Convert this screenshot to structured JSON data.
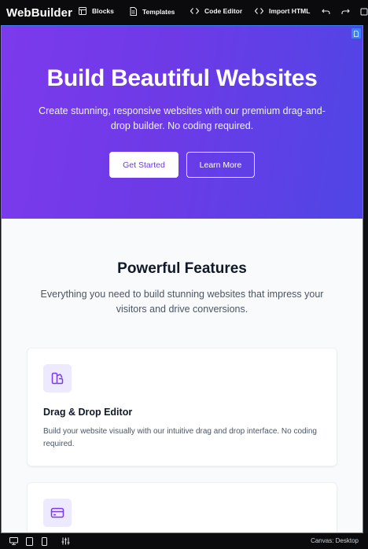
{
  "app": {
    "brand": "WebBuilder"
  },
  "toolbar": {
    "blocks_label": "Blocks",
    "templates_label": "Templates",
    "code_editor_label": "Code Editor",
    "import_html_label": "Import HTML"
  },
  "hero": {
    "title": "Build Beautiful Websites",
    "subtitle": "Create stunning, responsive websites with our premium drag-and-drop builder. No coding required.",
    "primary_button": "Get Started",
    "secondary_button": "Learn More"
  },
  "features": {
    "title": "Powerful Features",
    "subtitle": "Everything you need to build stunning websites that impress your visitors and drive conversions.",
    "cards": [
      {
        "title": "Drag & Drop Editor",
        "text": "Build your website visually with our intuitive drag and drop interface. No coding required.",
        "icon": "palette-icon"
      },
      {
        "title": "",
        "text": "",
        "icon": "credit-card-icon"
      }
    ]
  },
  "bottombar": {
    "canvas_status": "Canvas: Desktop"
  },
  "colors": {
    "accent": "#6d3ae6",
    "hero_start": "#7c3aed",
    "hero_end": "#4f46e5",
    "selection": "#3b82f6"
  }
}
